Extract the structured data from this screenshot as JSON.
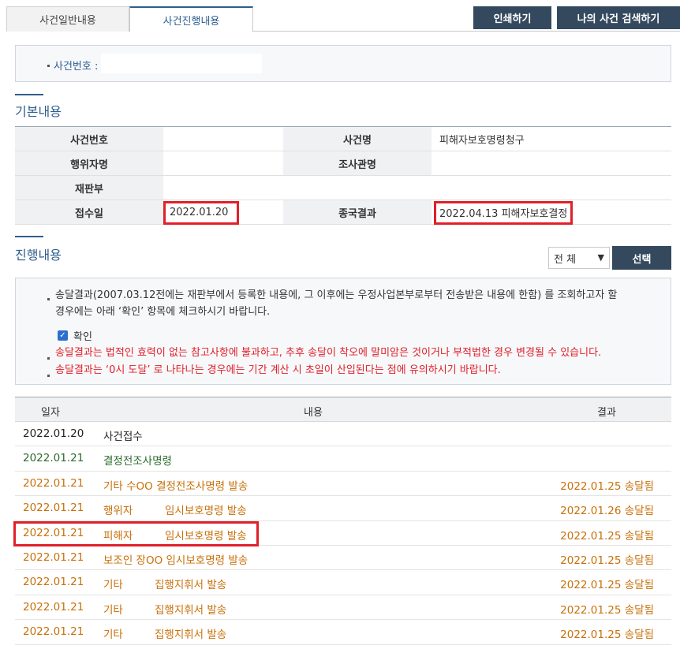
{
  "tabs": [
    {
      "label": "사건일반내용",
      "active": false
    },
    {
      "label": "사건진행내용",
      "active": true
    }
  ],
  "buttons": {
    "print": "인쇄하기",
    "my_case_search": "나의 사건 검색하기",
    "select": "선택"
  },
  "case_number_box": {
    "label": "사건번호 :",
    "value": ""
  },
  "basic_section": {
    "title": "기본내용",
    "rows": [
      {
        "h1": "사건번호",
        "v1": "",
        "h2": "사건명",
        "v2": "피해자보호명령청구"
      },
      {
        "h1": "행위자명",
        "v1": "",
        "h2": "조사관명",
        "v2": ""
      },
      {
        "h1": "재판부",
        "v1": "",
        "h2": "",
        "v2": ""
      },
      {
        "h1": "접수일",
        "v1": "2022.01.20",
        "h2": "종국결과",
        "v2": "2022.04.13 피해자보호결정"
      }
    ]
  },
  "progress_section": {
    "title": "진행내용",
    "filter_value": "전 체"
  },
  "notice": {
    "line1": "송달결과(2007.03.12전에는 재판부에서 등록한 내용에, 그 이후에는 우정사업본부로부터 전송받은 내용에 한함) 를 조회하고자 할",
    "line2": "경우에는 아래 ‘확인’ 항목에 체크하시기 바랍니다.",
    "checkbox_label": "확인",
    "warn1": "송달결과는 법적인 효력이 없는 참고사항에 불과하고, 추후 송달이 착오에 말미암은 것이거나 부적법한 경우 변경될 수 있습니다.",
    "warn2": "송달결과는 ‘0시 도달’ 로 나타나는 경우에는 기간 계산 시 초일이 산입된다는 점에 유의하시기 바랍니다."
  },
  "progress_table": {
    "headers": {
      "date": "일자",
      "content": "내용",
      "result": "결과"
    },
    "rows": [
      {
        "date": "2022.01.20",
        "c1": "사건접수",
        "c2": "",
        "result": "",
        "color": "black"
      },
      {
        "date": "2022.01.21",
        "c1": "결정전조사명령",
        "c2": "",
        "result": "",
        "color": "green"
      },
      {
        "date": "2022.01.21",
        "c1": "기타 수OO 결정전조사명령 발송",
        "c2": "",
        "result": "2022.01.25 송달됨",
        "color": "orange"
      },
      {
        "date": "2022.01.21",
        "c1": "행위자",
        "c2": "임시보호명령 발송",
        "result": "2022.01.26 송달됨",
        "color": "orange"
      },
      {
        "date": "2022.01.21",
        "c1": "피해자",
        "c2": "임시보호명령 발송",
        "result": "2022.01.25 송달됨",
        "color": "orange"
      },
      {
        "date": "2022.01.21",
        "c1": "보조인 장OO 임시보호명령 발송",
        "c2": "",
        "result": "2022.01.25 송달됨",
        "color": "orange"
      },
      {
        "date": "2022.01.21",
        "c1": "기타",
        "c2": "집행지휘서 발송",
        "result": "2022.01.25 송달됨",
        "color": "orange"
      },
      {
        "date": "2022.01.21",
        "c1": "기타",
        "c2": "집행지휘서 발송",
        "result": "2022.01.25 송달됨",
        "color": "orange"
      },
      {
        "date": "2022.01.21",
        "c1": "기타",
        "c2": "집행지휘서 발송",
        "result": "2022.01.25 송달됨",
        "color": "orange"
      }
    ]
  },
  "colors": {
    "navy_button": "#34495e",
    "accent_blue": "#2e5d8e",
    "highlight_red": "#e0202a",
    "orange_text": "#c8700a",
    "green_text": "#2b6a2b"
  }
}
